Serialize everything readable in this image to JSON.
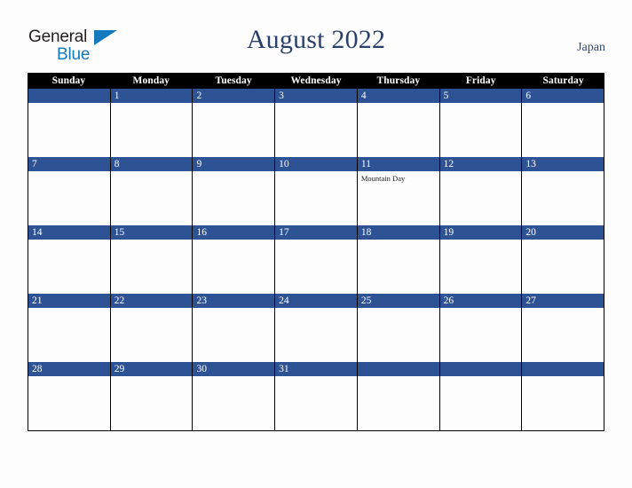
{
  "brand": {
    "name_part1": "General",
    "name_part2": "Blue",
    "accent_color": "#1479bd"
  },
  "header": {
    "title": "August 2022",
    "region": "Japan",
    "title_color": "#2b3f6c"
  },
  "calendar": {
    "weekday_headers": [
      "Sunday",
      "Monday",
      "Tuesday",
      "Wednesday",
      "Thursday",
      "Friday",
      "Saturday"
    ],
    "header_bg": "#000000",
    "date_bar_color": "#2e5395",
    "grid_line_color": "#000000",
    "weeks": [
      [
        {
          "date": "",
          "events": []
        },
        {
          "date": "1",
          "events": []
        },
        {
          "date": "2",
          "events": []
        },
        {
          "date": "3",
          "events": []
        },
        {
          "date": "4",
          "events": []
        },
        {
          "date": "5",
          "events": []
        },
        {
          "date": "6",
          "events": []
        }
      ],
      [
        {
          "date": "7",
          "events": []
        },
        {
          "date": "8",
          "events": []
        },
        {
          "date": "9",
          "events": []
        },
        {
          "date": "10",
          "events": []
        },
        {
          "date": "11",
          "events": [
            "Mountain Day"
          ]
        },
        {
          "date": "12",
          "events": []
        },
        {
          "date": "13",
          "events": []
        }
      ],
      [
        {
          "date": "14",
          "events": []
        },
        {
          "date": "15",
          "events": []
        },
        {
          "date": "16",
          "events": []
        },
        {
          "date": "17",
          "events": []
        },
        {
          "date": "18",
          "events": []
        },
        {
          "date": "19",
          "events": []
        },
        {
          "date": "20",
          "events": []
        }
      ],
      [
        {
          "date": "21",
          "events": []
        },
        {
          "date": "22",
          "events": []
        },
        {
          "date": "23",
          "events": []
        },
        {
          "date": "24",
          "events": []
        },
        {
          "date": "25",
          "events": []
        },
        {
          "date": "26",
          "events": []
        },
        {
          "date": "27",
          "events": []
        }
      ],
      [
        {
          "date": "28",
          "events": []
        },
        {
          "date": "29",
          "events": []
        },
        {
          "date": "30",
          "events": []
        },
        {
          "date": "31",
          "events": []
        },
        {
          "date": "",
          "events": []
        },
        {
          "date": "",
          "events": []
        },
        {
          "date": "",
          "events": []
        }
      ]
    ]
  }
}
